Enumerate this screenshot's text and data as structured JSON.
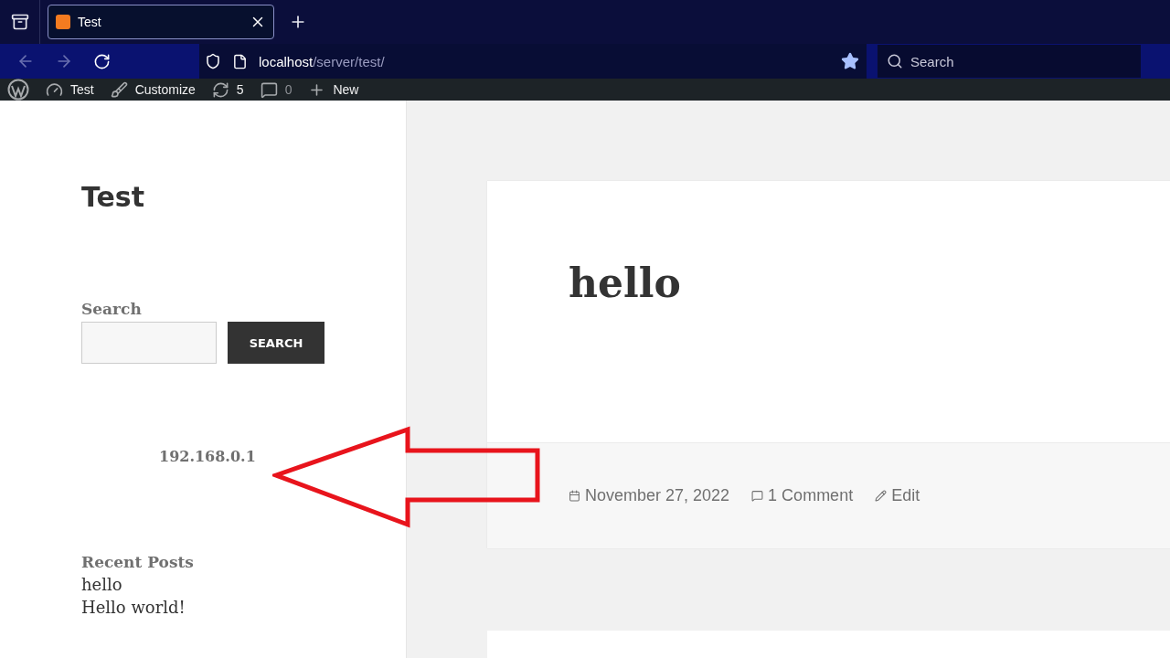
{
  "browser": {
    "tabs": [
      {
        "title": "Test",
        "selected": true
      }
    ],
    "url": {
      "host": "localhost",
      "path": "/server/test/"
    },
    "bookmarked": true,
    "search": {
      "placeholder": "Search"
    }
  },
  "admin_bar": [
    {
      "kind": "dashboard",
      "label": "Test",
      "muted": false
    },
    {
      "kind": "customize",
      "label": "Customize",
      "muted": false
    },
    {
      "kind": "updates",
      "label": "5",
      "muted": false
    },
    {
      "kind": "comments",
      "label": "0",
      "muted": true
    },
    {
      "kind": "new",
      "label": "New",
      "muted": false
    }
  ],
  "sidebar": {
    "site_title": "Test",
    "search_widget": {
      "title": "Search",
      "button": "SEARCH"
    },
    "ip_text": "192.168.0.1",
    "recent_posts": {
      "title": "Recent Posts",
      "items": [
        "hello",
        "Hello world!"
      ]
    }
  },
  "post": {
    "title": "hello",
    "meta": [
      {
        "kind": "date",
        "text": "November 27, 2022"
      },
      {
        "kind": "comments",
        "text": "1 Comment"
      },
      {
        "kind": "edit",
        "text": "Edit"
      }
    ]
  }
}
